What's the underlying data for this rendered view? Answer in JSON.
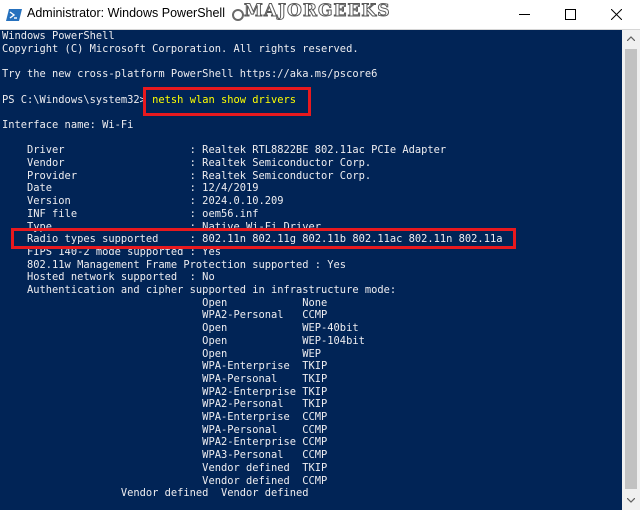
{
  "window": {
    "title": "Administrator: Windows PowerShell",
    "watermark": "MAJORGEEKS",
    "icons": [
      "powershell-icon",
      "minimize-icon",
      "maximize-icon",
      "close-icon"
    ]
  },
  "colors": {
    "console_background": "#012456",
    "console_text": "#eeedf0",
    "command_text": "#ffff00",
    "highlight_box": "#e8191e"
  },
  "console": {
    "header": [
      "Windows PowerShell",
      "Copyright (C) Microsoft Corporation. All rights reserved."
    ],
    "pscore_tip": "Try the new cross-platform PowerShell https://aka.ms/pscore6",
    "prompt": "PS C:\\Windows\\system32>",
    "command": "netsh wlan show drivers",
    "interface_line": "Interface name: Wi-Fi",
    "details": [
      "    Driver                    : Realtek RTL8822BE 802.11ac PCIe Adapter",
      "    Vendor                    : Realtek Semiconductor Corp.",
      "    Provider                  : Realtek Semiconductor Corp.",
      "    Date                      : 12/4/2019",
      "    Version                   : 2024.0.10.209",
      "    INF file                  : oem56.inf",
      "    Type                      : Native Wi-Fi Driver",
      "    Radio types supported     : 802.11n 802.11g 802.11b 802.11ac 802.11n 802.11a",
      "    FIPS 140-2 mode supported : Yes",
      "    802.11w Management Frame Protection supported : Yes",
      "    Hosted network supported  : No",
      "    Authentication and cipher supported in infrastructure mode:"
    ],
    "auth_pairs": [
      "                                Open            None",
      "                                WPA2-Personal   CCMP",
      "                                Open            WEP-40bit",
      "                                Open            WEP-104bit",
      "                                Open            WEP",
      "                                WPA-Enterprise  TKIP",
      "                                WPA-Personal    TKIP",
      "                                WPA2-Enterprise TKIP",
      "                                WPA2-Personal   TKIP",
      "                                WPA-Enterprise  CCMP",
      "                                WPA-Personal    CCMP",
      "                                WPA2-Enterprise CCMP",
      "                                WPA3-Personal   CCMP",
      "                                Vendor defined  TKIP",
      "                                Vendor defined  CCMP",
      "                   Vendor defined  Vendor defined"
    ]
  }
}
